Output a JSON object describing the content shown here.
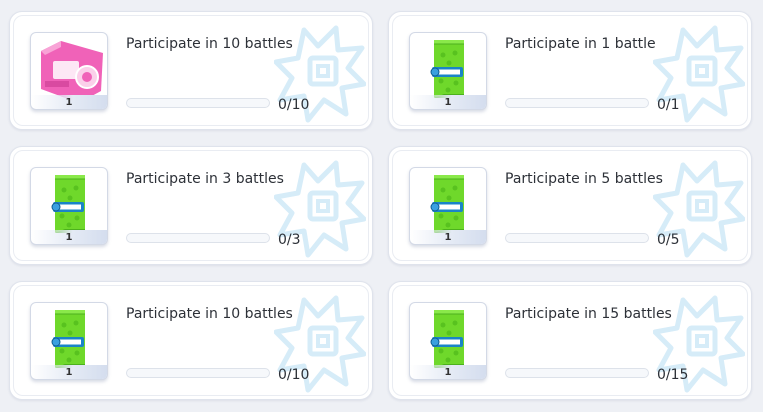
{
  "quests": [
    {
      "title": "Participate in 10 battles",
      "progress_text": "0/10",
      "progress": 0,
      "reward_icon": "pink-gift-card-icon",
      "reward_qty": "1"
    },
    {
      "title": "Participate in 1 battle",
      "progress_text": "0/1",
      "progress": 0,
      "reward_icon": "green-pack-icon",
      "reward_qty": "1"
    },
    {
      "title": "Participate in 3 battles",
      "progress_text": "0/3",
      "progress": 0,
      "reward_icon": "green-pack-icon",
      "reward_qty": "1"
    },
    {
      "title": "Participate in 5 battles",
      "progress_text": "0/5",
      "progress": 0,
      "reward_icon": "green-pack-icon",
      "reward_qty": "1"
    },
    {
      "title": "Participate in 10 battles",
      "progress_text": "0/10",
      "progress": 0,
      "reward_icon": "green-pack-icon",
      "reward_qty": "1"
    },
    {
      "title": "Participate in 15 battles",
      "progress_text": "0/15",
      "progress": 0,
      "reward_icon": "green-pack-icon",
      "reward_qty": "1"
    }
  ],
  "colors": {
    "card_bg": "#ffffff",
    "page_bg": "#eef0f5",
    "progress_fill": "#6ac14a",
    "deco_emblem": "#d6ecf8",
    "pack_green": "#6fd82b",
    "card_pink": "#f062b8"
  }
}
